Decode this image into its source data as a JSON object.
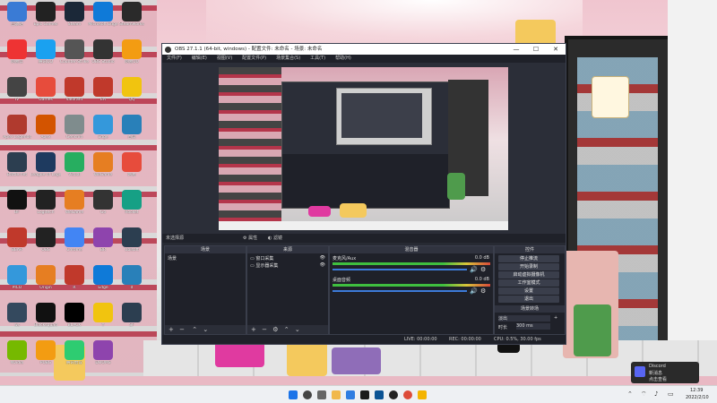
{
  "window": {
    "title": "OBS 27.1.1 (64-bit, windows) - 配置文件: 未命名 - 场景: 未命名",
    "minimize": "—",
    "maximize": "☐",
    "close": "✕"
  },
  "menu": [
    "文件(F)",
    "编辑(E)",
    "视图(V)",
    "配置文件(P)",
    "场景集合(S)",
    "工具(T)",
    "帮助(H)"
  ],
  "source_bar": {
    "label": "未选择源",
    "props": "属性",
    "filters": "滤镜"
  },
  "panels": {
    "scenes": {
      "title": "场景",
      "items": [
        "场景"
      ]
    },
    "sources": {
      "title": "来源",
      "items": [
        "窗口采集",
        "显示器采集"
      ]
    },
    "mixer": {
      "title": "混音器",
      "channels": [
        {
          "name": "麦克风/Aux",
          "db": "0.0 dB"
        },
        {
          "name": "桌面音频",
          "db": "0.0 dB"
        }
      ]
    },
    "controls": {
      "title": "控件",
      "buttons": [
        "停止推流",
        "开始录制",
        "启动虚拟摄像机",
        "工作室模式",
        "设置",
        "退出"
      ]
    },
    "transitions": {
      "title": "场景转场",
      "type": "淡出",
      "duration_label": "时长",
      "duration": "300 ms"
    }
  },
  "status": {
    "live": "LIVE: 00:00:00",
    "rec": "REC: 00:00:00",
    "cpu": "CPU: 0.5%, 30.00 fps"
  },
  "desktop_icons": [
    {
      "name": "回收站"
    },
    {
      "name": "Epic Games"
    },
    {
      "name": "Steam"
    },
    {
      "name": "Microsoft Edge"
    },
    {
      "name": "Steamworks"
    },
    {
      "name": "网易云"
    },
    {
      "name": "腾讯QQ"
    },
    {
      "name": "Counter-Strike"
    },
    {
      "name": "OBS Studio"
    },
    {
      "name": "网易UU"
    },
    {
      "name": "IV"
    },
    {
      "name": "Games"
    },
    {
      "name": "Valorant"
    },
    {
      "name": "EA"
    },
    {
      "name": "QQ"
    },
    {
      "name": "Apex Legends"
    },
    {
      "name": "Apex"
    },
    {
      "name": "Genshin"
    },
    {
      "name": "Edge"
    },
    {
      "name": "百度"
    },
    {
      "name": "Battle.net"
    },
    {
      "name": "League of Legends"
    },
    {
      "name": "Visual"
    },
    {
      "name": "WeGame"
    },
    {
      "name": "网易"
    },
    {
      "name": "BF"
    },
    {
      "name": "Logitech"
    },
    {
      "name": "WeGame"
    },
    {
      "name": "Go"
    },
    {
      "name": "Rocket"
    },
    {
      "name": "BEAR"
    },
    {
      "name": "OBS"
    },
    {
      "name": "Chrome"
    },
    {
      "name": "BR"
    },
    {
      "name": "Ubisoft"
    },
    {
      "name": "PICO"
    },
    {
      "name": "Origin"
    },
    {
      "name": "R"
    },
    {
      "name": "Edge"
    },
    {
      "name": "d"
    },
    {
      "name": "ws"
    },
    {
      "name": "Blacksquad"
    },
    {
      "name": "BLACK"
    },
    {
      "name": "Y"
    },
    {
      "name": "SF"
    },
    {
      "name": "Nvidia"
    },
    {
      "name": "PUBG"
    },
    {
      "name": "腾讯会议"
    },
    {
      "name": "DOOMS"
    }
  ],
  "notification": {
    "app": "Discord",
    "line1": "新消息",
    "line2": "点击查看"
  },
  "clock": {
    "time": "12:39",
    "date": "2022/2/10"
  },
  "colors": {
    "obs_bg": "#2b2e38",
    "panel_bg": "#1f2129",
    "accent_blue": "#3d7bd9",
    "meter_green": "#3fbf3f"
  }
}
